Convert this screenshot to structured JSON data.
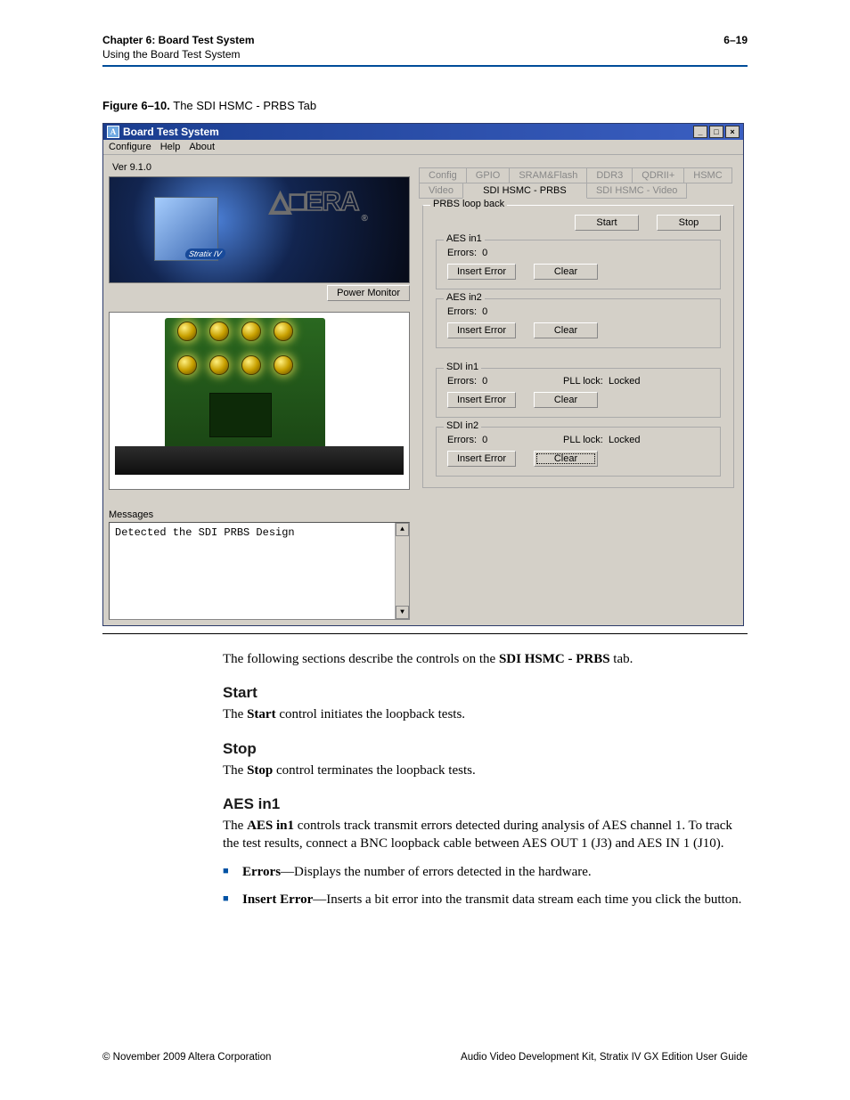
{
  "header": {
    "chapter": "Chapter 6:  Board Test System",
    "subtitle": "Using the Board Test System",
    "pagenum": "6–19"
  },
  "figure": {
    "number": "Figure 6–10.",
    "title": "  The SDI HSMC - PRBS Tab"
  },
  "window": {
    "title": "Board Test System",
    "icon_glyph": "A",
    "menus": [
      "Configure",
      "Help",
      "About"
    ],
    "version": "Ver 9.1.0",
    "chip_badge": "Stratix IV",
    "logo_text": "△□ERA",
    "power_monitor_btn": "Power Monitor",
    "messages_label": "Messages",
    "message_text": "Detected the SDI PRBS Design",
    "tabs_row1": [
      "Config",
      "GPIO",
      "SRAM&Flash",
      "DDR3",
      "QDRII+",
      "HSMC"
    ],
    "tabs_row2": [
      "Video",
      "SDI HSMC - PRBS",
      "SDI HSMC - Video"
    ],
    "active_tab": "SDI HSMC - PRBS",
    "prbs_group": {
      "title": "PRBS loop back",
      "start": "Start",
      "stop": "Stop",
      "groups": [
        {
          "name": "AES in1",
          "errors_label": "Errors:",
          "errors_value": "0",
          "pll_label": "",
          "pll_value": "",
          "insert": "Insert Error",
          "clear": "Clear"
        },
        {
          "name": "AES in2",
          "errors_label": "Errors:",
          "errors_value": "0",
          "pll_label": "",
          "pll_value": "",
          "insert": "Insert Error",
          "clear": "Clear"
        },
        {
          "name": "SDI in1",
          "errors_label": "Errors:",
          "errors_value": "0",
          "pll_label": "PLL lock:",
          "pll_value": "Locked",
          "insert": "Insert Error",
          "clear": "Clear"
        },
        {
          "name": "SDI in2",
          "errors_label": "Errors:",
          "errors_value": "0",
          "pll_label": "PLL lock:",
          "pll_value": "Locked",
          "insert": "Insert Error",
          "clear": "Clear"
        }
      ]
    }
  },
  "body": {
    "intro_pre": "The following sections describe the controls on the ",
    "intro_bold": "SDI HSMC - PRBS",
    "intro_post": " tab.",
    "sections": {
      "start": {
        "head": "Start",
        "text_pre": "The ",
        "text_bold": "Start",
        "text_post": " control initiates the loopback tests."
      },
      "stop": {
        "head": "Stop",
        "text_pre": "The ",
        "text_bold": "Stop",
        "text_post": " control terminates the loopback tests."
      },
      "aes": {
        "head": "AES in1",
        "text_pre": "The ",
        "text_bold": "AES in1",
        "text_post": " controls track transmit errors detected during analysis of AES channel 1. To track the test results, connect a BNC loopback cable between AES OUT 1 (J3) and AES IN 1 (J10).",
        "bullets": [
          {
            "bold": "Errors",
            "rest": "—Displays the number of errors detected in the hardware."
          },
          {
            "bold": "Insert Error",
            "rest": "—Inserts a bit error into the transmit data stream each time you click the button."
          }
        ]
      }
    }
  },
  "footer": {
    "left": "© November 2009    Altera Corporation",
    "right": "Audio Video Development Kit, Stratix IV GX Edition User Guide"
  }
}
